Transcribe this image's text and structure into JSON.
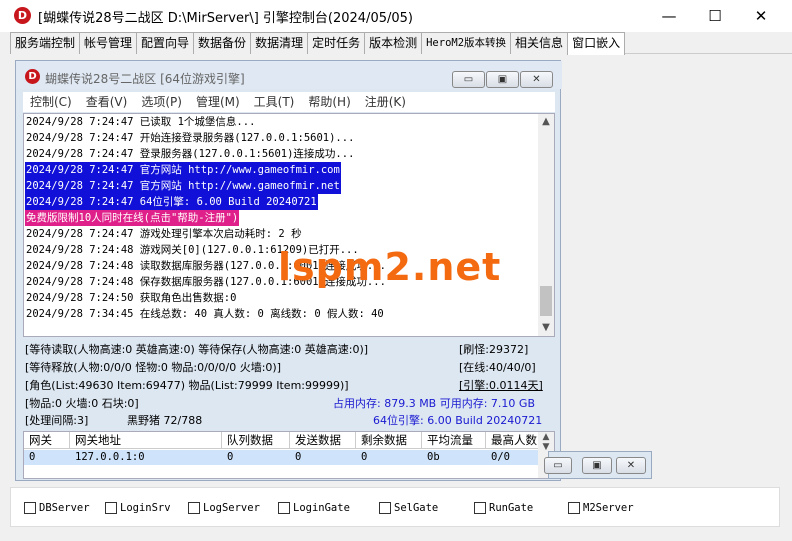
{
  "window": {
    "title": "[蝴蝶传说28号二战区 D:\\MirServer\\] 引擎控制台(2024/05/05)",
    "logo_letter": "D",
    "minimize": "—",
    "maximize": "☐",
    "close": "✕"
  },
  "tabs": [
    "服务端控制",
    "帐号管理",
    "配置向导",
    "数据备份",
    "数据清理",
    "定时任务",
    "版本检测",
    "HeroM2版本转换",
    "相关信息",
    "窗口嵌入"
  ],
  "child": {
    "title": "蝴蝶传说28号二战区 [64位游戏引擎]",
    "logo_letter": "D",
    "buttons": {
      "minimize": "▭",
      "restore": "▣",
      "close": "✕"
    },
    "menu": [
      "控制(C)",
      "查看(V)",
      "选项(P)",
      "管理(M)",
      "工具(T)",
      "帮助(H)",
      "注册(K)"
    ],
    "log": [
      {
        "text": "2024/9/28 7:24:47 已读取 1个城堡信息...",
        "style": ""
      },
      {
        "text": "2024/9/28 7:24:47 开始连接登录服务器(127.0.0.1:5601)...",
        "style": ""
      },
      {
        "text": "2024/9/28 7:24:47 登录服务器(127.0.0.1:5601)连接成功...",
        "style": ""
      },
      {
        "text": "2024/9/28 7:24:47 官方网站 http://www.gameofmir.com",
        "style": "blue"
      },
      {
        "text": "2024/9/28 7:24:47 官方网站 http://www.gameofmir.net",
        "style": "blue"
      },
      {
        "text": "2024/9/28 7:24:47 64位引擎: 6.00 Build 20240721",
        "style": "blue"
      },
      {
        "text": "免费版限制10人同时在线(点击\"帮助-注册\")",
        "style": "pink"
      },
      {
        "text": "2024/9/28 7:24:47 游戏处理引擎本次启动耗时: 2 秒",
        "style": ""
      },
      {
        "text": "2024/9/28 7:24:48 游戏网关[0](127.0.0.1:61209)已打开...",
        "style": ""
      },
      {
        "text": "2024/9/28 7:24:48 读取数据库服务器(127.0.0.1:6001)连接成功...",
        "style": ""
      },
      {
        "text": "2024/9/28 7:24:48 保存数据库服务器(127.0.0.1:6001)连接成功...",
        "style": ""
      },
      {
        "text": "2024/9/28 7:24:50 获取角色出售数据:0",
        "style": ""
      },
      {
        "text": "2024/9/28 7:34:45 在线总数: 40 真人数: 0 离线数: 0 假人数: 40",
        "style": ""
      }
    ],
    "stats": {
      "wait_read": "[等待读取(人物高速:0 英雄高速:0) 等待保存(人物高速:0 英雄高速:0)]",
      "refresh": "[刷怪:29372]",
      "wait_release": "[等待释放(人物:0/0/0 怪物:0 物品:0/0/0/0 火墙:0)]",
      "online": "[在线:40/40/0]",
      "role": "[角色(List:49630 Item:69477) 物品(List:79999 Item:99999)]",
      "engine": "[引擎:0.0114天]",
      "items": "[物品:0 火墙:0 石块:0]",
      "memory": "占用内存: 879.3 MB 可用内存: 7.10 GB",
      "interval": "[处理间隔:3]",
      "monster": "黑野猪 72/788",
      "build": "64位引擎: 6.00 Build 20240721"
    },
    "grid": {
      "headers": [
        "网关",
        "网关地址",
        "队列数据",
        "发送数据",
        "剩余数据",
        "平均流量",
        "最高人数"
      ],
      "rows": [
        [
          "0",
          "127.0.0.1:0",
          "0",
          "0",
          "0",
          "0b",
          "0/0"
        ]
      ]
    }
  },
  "servers": [
    "DBServer",
    "LoginSrv",
    "LogServer",
    "LoginGate",
    "SelGate",
    "RunGate",
    "M2Server"
  ],
  "watermark": "lspm2.net"
}
